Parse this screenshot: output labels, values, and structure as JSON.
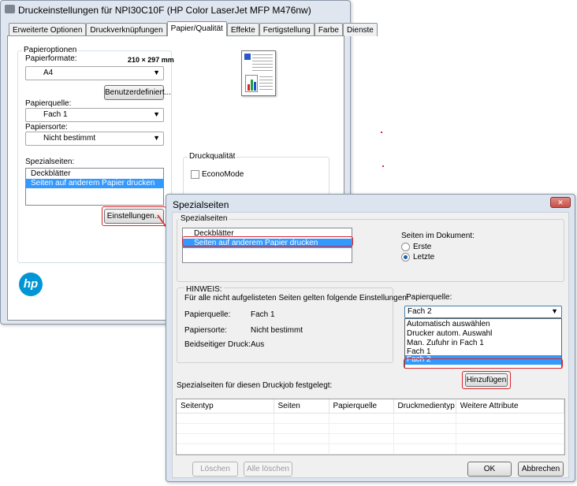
{
  "back_window": {
    "title": "Druckeinstellungen für NPI30C10F (HP Color LaserJet MFP M476nw)",
    "tabs": [
      "Erweiterte Optionen",
      "Druckverknüpfungen",
      "Papier/Qualität",
      "Effekte",
      "Fertigstellung",
      "Farbe",
      "Dienste"
    ],
    "active_tab": "Papier/Qualität",
    "paper_options": {
      "group_label": "Papieroptionen",
      "formats_label": "Papierformate:",
      "size_text": "210 × 297 mm",
      "format_value": "A4",
      "custom_button": "Benutzerdefiniert...",
      "source_label": "Papierquelle:",
      "source_value": "Fach 1",
      "type_label": "Papiersorte:",
      "type_value": "Nicht bestimmt",
      "special_label": "Spezialseiten:",
      "special_items": [
        "Deckblätter",
        "Seiten auf anderem Papier drucken"
      ],
      "settings_button": "Einstellungen..."
    },
    "quality": {
      "group_label": "Druckqualität",
      "economode_label": "EconoMode"
    },
    "logo_text": "hp"
  },
  "dialog": {
    "title": "Spezialseiten",
    "close_glyph": "✕",
    "group_label": "Spezialseiten",
    "list_items": [
      "Deckblätter",
      "Seiten auf anderem Papier drucken"
    ],
    "pages_label": "Seiten im Dokument:",
    "radio_first": "Erste",
    "radio_last": "Letzte",
    "hint_title": "HINWEIS:",
    "hint_text": "Für alle nicht aufgelisteten Seiten gelten folgende Einstellungen:",
    "hint_rows": [
      {
        "label": "Papierquelle:",
        "value": "Fach 1"
      },
      {
        "label": "Papiersorte:",
        "value": "Nicht bestimmt"
      },
      {
        "label": "Beidseitiger Druck:",
        "value": "Aus"
      }
    ],
    "source_label": "Papierquelle:",
    "source_value": "Fach 2",
    "dropdown_options": [
      "Automatisch auswählen",
      "Drucker autom. Auswahl",
      "Man. Zufuhr in Fach 1",
      "Fach 1",
      "Fach 2"
    ],
    "selected_option": "Fach 2",
    "add_button": "Hinzufügen",
    "table_label": "Spezialseiten für diesen Druckjob festgelegt:",
    "table_columns": [
      "Seitentyp",
      "Seiten",
      "Papierquelle",
      "Druckmedientyp",
      "Weitere Attribute"
    ],
    "delete_button": "Löschen",
    "delete_all_button": "Alle löschen",
    "ok_button": "OK",
    "cancel_button": "Abbrechen"
  },
  "colors": {
    "highlight": "#d9262c",
    "selection": "#3399ff",
    "hp_blue": "#0096d6",
    "close_button": "#c7504a"
  }
}
